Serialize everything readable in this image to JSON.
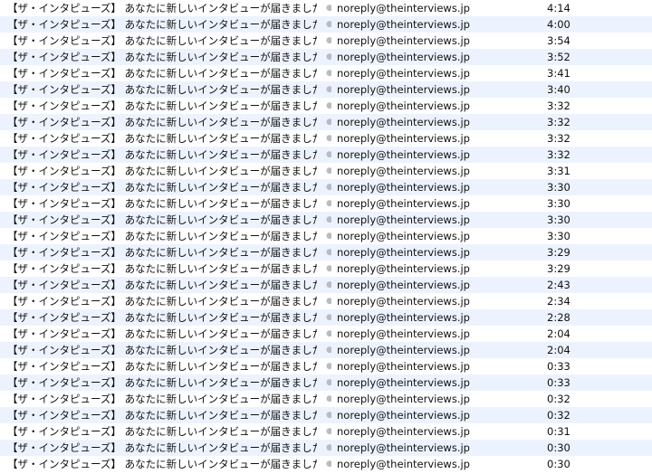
{
  "messages": [
    {
      "subject": "【ザ・インタピューズ】 あなたに新しいインタビューが届きました",
      "sender": "noreply@theinterviews.jp",
      "time": "4:14"
    },
    {
      "subject": "【ザ・インタピューズ】 あなたに新しいインタビューが届きました",
      "sender": "noreply@theinterviews.jp",
      "time": "4:00"
    },
    {
      "subject": "【ザ・インタピューズ】 あなたに新しいインタビューが届きました",
      "sender": "noreply@theinterviews.jp",
      "time": "3:54"
    },
    {
      "subject": "【ザ・インタピューズ】 あなたに新しいインタビューが届きました",
      "sender": "noreply@theinterviews.jp",
      "time": "3:52"
    },
    {
      "subject": "【ザ・インタピューズ】 あなたに新しいインタビューが届きました",
      "sender": "noreply@theinterviews.jp",
      "time": "3:41"
    },
    {
      "subject": "【ザ・インタピューズ】 あなたに新しいインタビューが届きました",
      "sender": "noreply@theinterviews.jp",
      "time": "3:40"
    },
    {
      "subject": "【ザ・インタピューズ】 あなたに新しいインタビューが届きました",
      "sender": "noreply@theinterviews.jp",
      "time": "3:32"
    },
    {
      "subject": "【ザ・インタピューズ】 あなたに新しいインタビューが届きました",
      "sender": "noreply@theinterviews.jp",
      "time": "3:32"
    },
    {
      "subject": "【ザ・インタピューズ】 あなたに新しいインタビューが届きました",
      "sender": "noreply@theinterviews.jp",
      "time": "3:32"
    },
    {
      "subject": "【ザ・インタピューズ】 あなたに新しいインタビューが届きました",
      "sender": "noreply@theinterviews.jp",
      "time": "3:32"
    },
    {
      "subject": "【ザ・インタピューズ】 あなたに新しいインタビューが届きました",
      "sender": "noreply@theinterviews.jp",
      "time": "3:31"
    },
    {
      "subject": "【ザ・インタピューズ】 あなたに新しいインタビューが届きました",
      "sender": "noreply@theinterviews.jp",
      "time": "3:30"
    },
    {
      "subject": "【ザ・インタピューズ】 あなたに新しいインタビューが届きました",
      "sender": "noreply@theinterviews.jp",
      "time": "3:30"
    },
    {
      "subject": "【ザ・インタピューズ】 あなたに新しいインタビューが届きました",
      "sender": "noreply@theinterviews.jp",
      "time": "3:30"
    },
    {
      "subject": "【ザ・インタピューズ】 あなたに新しいインタビューが届きました",
      "sender": "noreply@theinterviews.jp",
      "time": "3:30"
    },
    {
      "subject": "【ザ・インタピューズ】 あなたに新しいインタビューが届きました",
      "sender": "noreply@theinterviews.jp",
      "time": "3:29"
    },
    {
      "subject": "【ザ・インタピューズ】 あなたに新しいインタビューが届きました",
      "sender": "noreply@theinterviews.jp",
      "time": "3:29"
    },
    {
      "subject": "【ザ・インタピューズ】 あなたに新しいインタビューが届きました",
      "sender": "noreply@theinterviews.jp",
      "time": "2:43"
    },
    {
      "subject": "【ザ・インタピューズ】 あなたに新しいインタビューが届きました",
      "sender": "noreply@theinterviews.jp",
      "time": "2:34"
    },
    {
      "subject": "【ザ・インタピューズ】 あなたに新しいインタビューが届きました",
      "sender": "noreply@theinterviews.jp",
      "time": "2:28"
    },
    {
      "subject": "【ザ・インタピューズ】 あなたに新しいインタビューが届きました",
      "sender": "noreply@theinterviews.jp",
      "time": "2:04"
    },
    {
      "subject": "【ザ・インタピューズ】 あなたに新しいインタビューが届きました",
      "sender": "noreply@theinterviews.jp",
      "time": "2:04"
    },
    {
      "subject": "【ザ・インタピューズ】 あなたに新しいインタビューが届きました",
      "sender": "noreply@theinterviews.jp",
      "time": "0:33"
    },
    {
      "subject": "【ザ・インタピューズ】 あなたに新しいインタビューが届きました",
      "sender": "noreply@theinterviews.jp",
      "time": "0:33"
    },
    {
      "subject": "【ザ・インタピューズ】 あなたに新しいインタビューが届きました",
      "sender": "noreply@theinterviews.jp",
      "time": "0:32"
    },
    {
      "subject": "【ザ・インタピューズ】 あなたに新しいインタビューが届きました",
      "sender": "noreply@theinterviews.jp",
      "time": "0:32"
    },
    {
      "subject": "【ザ・インタピューズ】 あなたに新しいインタビューが届きました",
      "sender": "noreply@theinterviews.jp",
      "time": "0:31"
    },
    {
      "subject": "【ザ・インタピューズ】 あなたに新しいインタビューが届きました",
      "sender": "noreply@theinterviews.jp",
      "time": "0:30"
    },
    {
      "subject": "【ザ・インタピューズ】 あなたに新しいインタビューが届きました",
      "sender": "noreply@theinterviews.jp",
      "time": "0:30"
    }
  ],
  "icons": {
    "separator": "dot-icon"
  },
  "colors": {
    "row_alt": "#edf3fe",
    "text": "#111111",
    "dot": "#b9bcc2"
  }
}
